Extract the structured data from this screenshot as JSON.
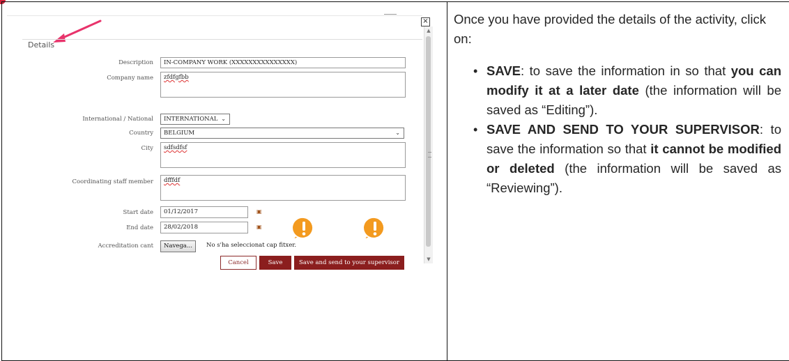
{
  "form": {
    "section_title": "Details",
    "fields": [
      {
        "label": "Description",
        "value": "IN-COMPANY WORK (XXXXXXXXXXXXXXX)"
      },
      {
        "label": "Company name",
        "value": "zfdfgfbb"
      },
      {
        "label": "International / National",
        "value": "INTERNATIONAL"
      },
      {
        "label": "Country",
        "value": "BELGIUM"
      },
      {
        "label": "City",
        "value": "sdfsdfsf"
      },
      {
        "label": "Coordinating staff member",
        "value": "dfffdf"
      },
      {
        "label": "Start date",
        "value": "01/12/2017"
      },
      {
        "label": "End date",
        "value": "28/02/2018"
      },
      {
        "label": "Accreditation cant",
        "value": ""
      }
    ],
    "file_button": "Navega...",
    "file_status": "No s'ha seleccionat cap fitxer.",
    "buttons": {
      "cancel": "Cancel",
      "save": "Save",
      "send": "Save and send to your supervisor"
    },
    "close_symbol": "×",
    "colors": {
      "button": "#8b1e1e",
      "arrow": "#e8336b",
      "warning": "#f39a1f"
    }
  },
  "instructions": {
    "intro": "Once you have provided the details of the activity, click on:",
    "item1": {
      "head": "SAVE",
      "t1": ": to save the information in so that ",
      "b1": "you can modify it at a later date",
      "t2": " (the information will be saved as “Editing”)."
    },
    "item2": {
      "head": "SAVE AND SEND TO YOUR SUPERVISOR",
      "t1": ": to save the information so that ",
      "b1": "it cannot be modified or deleted",
      "t2": " (the information will be saved as “Reviewing”)."
    }
  }
}
